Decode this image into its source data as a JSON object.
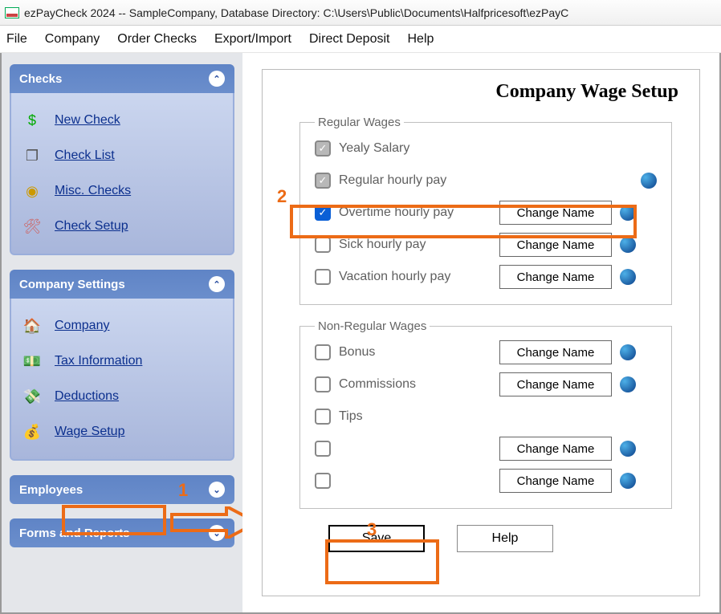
{
  "title": "ezPayCheck 2024 -- SampleCompany, Database Directory: C:\\Users\\Public\\Documents\\Halfpricesoft\\ezPayC",
  "menubar": [
    "File",
    "Company",
    "Order Checks",
    "Export/Import",
    "Direct Deposit",
    "Help"
  ],
  "panels": {
    "checks": {
      "title": "Checks",
      "items": [
        {
          "label": "New Check",
          "icon": "dollar"
        },
        {
          "label": "Check List",
          "icon": "stack"
        },
        {
          "label": "Misc. Checks",
          "icon": "pin"
        },
        {
          "label": "Check Setup",
          "icon": "wrench"
        }
      ]
    },
    "company_settings": {
      "title": "Company Settings",
      "items": [
        {
          "label": "Company",
          "icon": "house"
        },
        {
          "label": "Tax Information",
          "icon": "cash"
        },
        {
          "label": "Deductions",
          "icon": "cash-minus"
        },
        {
          "label": "Wage Setup",
          "icon": "cash-plus"
        }
      ]
    },
    "employees": {
      "title": "Employees"
    },
    "forms": {
      "title": "Forms and Reports"
    }
  },
  "page": {
    "title": "Company Wage Setup",
    "regular": {
      "legend": "Regular Wages",
      "rows": [
        {
          "label": "Yealy Salary",
          "readonly": true,
          "checked": true,
          "changeName": false,
          "help": false
        },
        {
          "label": "Regular hourly pay",
          "readonly": true,
          "checked": true,
          "changeName": false,
          "help": true
        },
        {
          "label": "Overtime hourly pay",
          "readonly": false,
          "checked": true,
          "changeName": true,
          "help": true
        },
        {
          "label": "Sick hourly pay",
          "readonly": false,
          "checked": false,
          "changeName": true,
          "help": true
        },
        {
          "label": "Vacation hourly pay",
          "readonly": false,
          "checked": false,
          "changeName": true,
          "help": true
        }
      ]
    },
    "nonregular": {
      "legend": "Non-Regular Wages",
      "rows": [
        {
          "label": "Bonus",
          "checked": false,
          "changeName": true,
          "help": true
        },
        {
          "label": "Commissions",
          "checked": false,
          "changeName": true,
          "help": true
        },
        {
          "label": "Tips",
          "checked": false,
          "changeName": false,
          "help": false
        },
        {
          "label": "",
          "checked": false,
          "changeName": true,
          "help": true
        },
        {
          "label": "",
          "checked": false,
          "changeName": true,
          "help": true
        }
      ]
    },
    "change_label": "Change Name",
    "save": "Save",
    "help": "Help"
  },
  "annotations": {
    "n1": "1",
    "n2": "2",
    "n3": "3"
  }
}
